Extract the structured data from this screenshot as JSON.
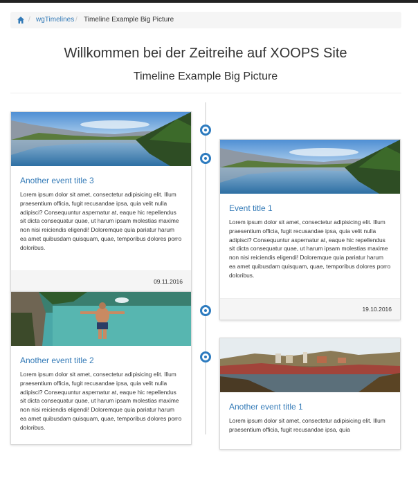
{
  "breadcrumb": {
    "home_icon": "home-icon",
    "items": [
      "wgTimelines",
      "Timeline Example Big Picture"
    ]
  },
  "page": {
    "title": "Willkommen bei der Zeitreihe auf XOOPS Site",
    "subtitle": "Timeline Example Big Picture"
  },
  "colors": {
    "accent": "#2d7bbf",
    "link": "#337ab7"
  },
  "events": [
    {
      "title": "Another event title 3",
      "text": "Lorem ipsum dolor sit amet, consectetur adipisicing elit. Illum praesentium officia, fugit recusandae ipsa, quia velit nulla adipisci? Consequuntur aspernatur at, eaque hic repellendus sit dicta consequatur quae, ut harum ipsam molestias maxime non nisi reiciendis eligendi! Doloremque quia pariatur harum ea amet quibusdam quisquam, quae, temporibus dolores porro doloribus.",
      "date": "09.11.2016"
    },
    {
      "title": "Event title 1",
      "text": "Lorem ipsum dolor sit amet, consectetur adipisicing elit. Illum praesentium officia, fugit recusandae ipsa, quia velit nulla adipisci? Consequuntur aspernatur at, eaque hic repellendus sit dicta consequatur quae, ut harum ipsam molestias maxime non nisi reiciendis eligendi! Doloremque quia pariatur harum ea amet quibusdam quisquam, quae, temporibus dolores porro doloribus.",
      "date": "19.10.2016"
    },
    {
      "title": "Another event title 2",
      "text": "Lorem ipsum dolor sit amet, consectetur adipisicing elit. Illum praesentium officia, fugit recusandae ipsa, quia velit nulla adipisci? Consequuntur aspernatur at, eaque hic repellendus sit dicta consequatur quae, ut harum ipsam molestias maxime non nisi reiciendis eligendi! Doloremque quia pariatur harum ea amet quibusdam quisquam, quae, temporibus dolores porro doloribus."
    },
    {
      "title": "Another event title 1",
      "text": "Lorem ipsum dolor sit amet, consectetur adipisicing elit. Illum praesentium officia, fugit recusandae ipsa, quia"
    }
  ]
}
